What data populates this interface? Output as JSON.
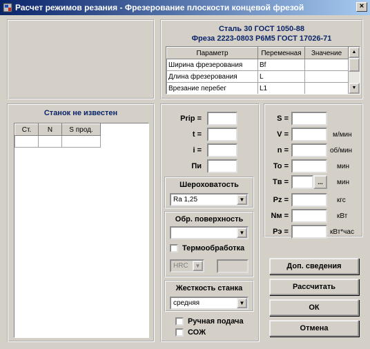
{
  "window": {
    "title": "Расчет режимов резания - Фрезерование плоскости концевой фрезой",
    "close_label": "×"
  },
  "header": {
    "material": "Сталь 30 ГОСТ 1050-88",
    "tool": "Фреза 2223-0803 Р6М5 ГОСТ 17026-71"
  },
  "param_table": {
    "columns": [
      "Параметр",
      "Переменная",
      "Значение"
    ],
    "rows": [
      {
        "param": "Ширина фрезерования",
        "var": "Bf",
        "value": ""
      },
      {
        "param": "Длина фрезерования",
        "var": "L",
        "value": ""
      },
      {
        "param": "Врезание перебег",
        "var": "L1",
        "value": ""
      }
    ]
  },
  "machine": {
    "title": "Станок не известен",
    "columns": [
      "Ст.",
      "N",
      "S прод."
    ]
  },
  "inputs_left": [
    {
      "label": "Рrip =",
      "value": ""
    },
    {
      "label": "t =",
      "value": ""
    },
    {
      "label": "i =",
      "value": ""
    },
    {
      "label": "Пи",
      "value": ""
    }
  ],
  "roughness": {
    "title": "Шероховатость",
    "selected": "Ra 1,25"
  },
  "surface": {
    "title": "Обр. поверхность",
    "selected": ""
  },
  "heat_treatment": {
    "label": "Термообработка",
    "hardness": "HRC",
    "value": ""
  },
  "rigidity": {
    "title": "Жесткость станка",
    "selected": "средняя"
  },
  "options": {
    "manual_feed": "Ручная подача",
    "coolant": "СОЖ"
  },
  "results": [
    {
      "label": "S =",
      "unit": ""
    },
    {
      "label": "V =",
      "unit": "м/мин"
    },
    {
      "label": "n =",
      "unit": "об/мин"
    },
    {
      "label": "To =",
      "unit": "мин"
    },
    {
      "label": "Tв =",
      "unit": "мин",
      "button": "..."
    },
    {
      "label": "Pz =",
      "unit": "кгс"
    },
    {
      "label": "Nм =",
      "unit": "кВт"
    },
    {
      "label": "Pэ =",
      "unit": "кВт*час"
    }
  ],
  "buttons": {
    "extra": "Доп. сведения",
    "calc": "Рассчитать",
    "ok": "ОК",
    "cancel": "Отмена"
  }
}
